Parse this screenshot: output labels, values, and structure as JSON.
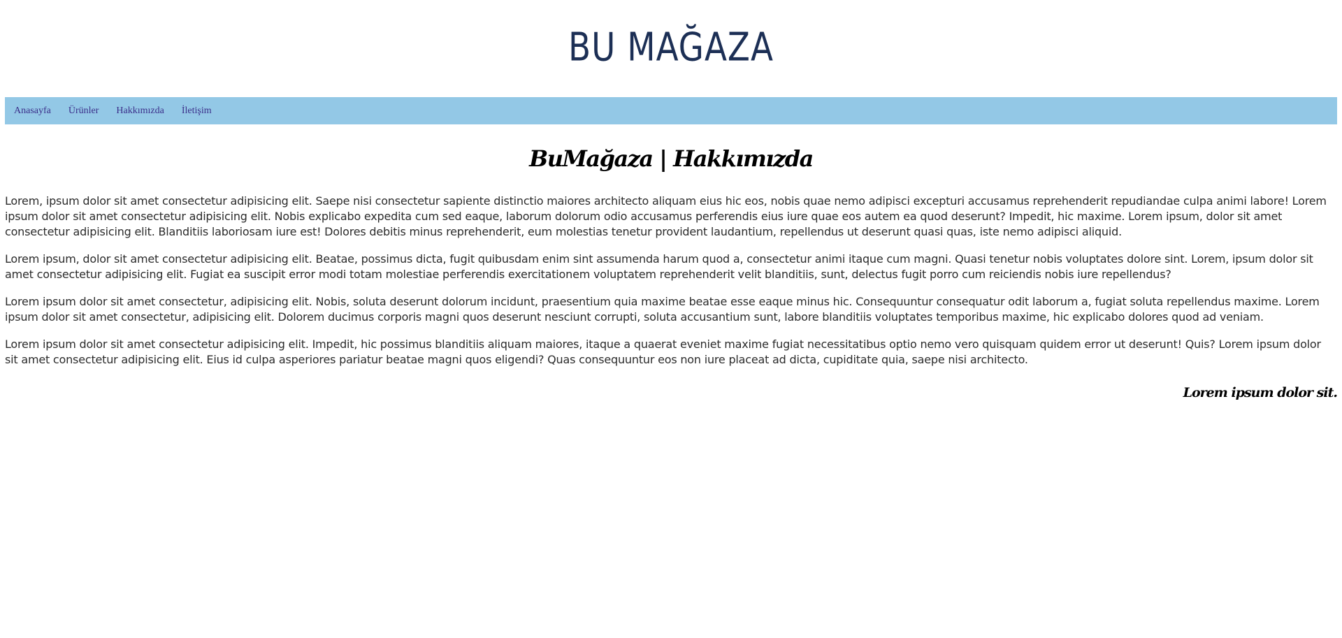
{
  "header": {
    "logo_text": "BU MAĞAZA"
  },
  "nav": {
    "items": [
      {
        "label": "Anasayfa"
      },
      {
        "label": "Ürünler"
      },
      {
        "label": "Hakkımızda"
      },
      {
        "label": "İletişim"
      }
    ]
  },
  "main": {
    "title": "BuMağaza | Hakkımızda",
    "paragraphs": [
      "Lorem, ipsum dolor sit amet consectetur adipisicing elit. Saepe nisi consectetur sapiente distinctio maiores architecto aliquam eius hic eos, nobis quae nemo adipisci excepturi accusamus reprehenderit repudiandae culpa animi labore! Lorem ipsum dolor sit amet consectetur adipisicing elit. Nobis explicabo expedita cum sed eaque, laborum dolorum odio accusamus perferendis eius iure quae eos autem ea quod deserunt? Impedit, hic maxime. Lorem ipsum, dolor sit amet consectetur adipisicing elit. Blanditiis laboriosam iure est! Dolores debitis minus reprehenderit, eum molestias tenetur provident laudantium, repellendus ut deserunt quasi quas, iste nemo adipisci aliquid.",
      "Lorem ipsum, dolor sit amet consectetur adipisicing elit. Beatae, possimus dicta, fugit quibusdam enim sint assumenda harum quod a, consectetur animi itaque cum magni. Quasi tenetur nobis voluptates dolore sint. Lorem, ipsum dolor sit amet consectetur adipisicing elit. Fugiat ea suscipit error modi totam molestiae perferendis exercitationem voluptatem reprehenderit velit blanditiis, sunt, delectus fugit porro cum reiciendis nobis iure repellendus?",
      "Lorem ipsum dolor sit amet consectetur, adipisicing elit. Nobis, soluta deserunt dolorum incidunt, praesentium quia maxime beatae esse eaque minus hic. Consequuntur consequatur odit laborum a, fugiat soluta repellendus maxime. Lorem ipsum dolor sit amet consectetur, adipisicing elit. Dolorem ducimus corporis magni quos deserunt nesciunt corrupti, soluta accusantium sunt, labore blanditiis voluptates temporibus maxime, hic explicabo dolores quod ad veniam.",
      "Lorem ipsum dolor sit amet consectetur adipisicing elit. Impedit, hic possimus blanditiis aliquam maiores, itaque a quaerat eveniet maxime fugiat necessitatibus optio nemo vero quisquam quidem error ut deserunt! Quis? Lorem ipsum dolor sit amet consectetur adipisicing elit. Eius id culpa asperiores pariatur beatae magni quos eligendi? Quas consequuntur eos non iure placeat ad dicta, cupiditate quia, saepe nisi architecto."
    ],
    "signature": "Lorem ipsum dolor sit."
  },
  "colors": {
    "logo": "#1c2f55",
    "navbar_bg": "#93c8e6",
    "nav_link": "#3b2f8a",
    "body_text": "#2b2b2b"
  }
}
